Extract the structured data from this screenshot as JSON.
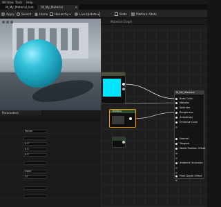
{
  "menu": [
    "Window",
    "Tools",
    "Help"
  ],
  "tabs": [
    {
      "label": "M_My_Material_Inst"
    },
    {
      "label": "M_My_Material",
      "active": true
    }
  ],
  "toolbar": {
    "apply": "Apply",
    "search": "Search",
    "home": "Home",
    "hierarchy": "Hierarchy",
    "live_update": "Live Update",
    "stats": "Stats",
    "platform_stats": "Platform Stats"
  },
  "graph": {
    "tab_label": "Material Graph",
    "node_b_label": "Multiply",
    "main_node": {
      "title": "M_My_Material",
      "inputs": [
        {
          "label": "Base Color",
          "connected": true
        },
        {
          "label": "Metallic",
          "connected": true
        },
        {
          "label": "Specular",
          "connected": false
        },
        {
          "label": "Roughness",
          "connected": true
        },
        {
          "label": "Anisotropy",
          "connected": false
        },
        {
          "label": "Emissive Color",
          "connected": false
        },
        {
          "label": "",
          "connected": false
        },
        {
          "label": "Normal",
          "connected": false
        },
        {
          "label": "Tangent",
          "connected": false
        },
        {
          "label": "World Position Offset",
          "connected": false
        },
        {
          "label": "",
          "connected": false
        },
        {
          "label": "",
          "connected": false
        },
        {
          "label": "Ambient Occlusion",
          "connected": false
        },
        {
          "label": "",
          "connected": false
        },
        {
          "label": "",
          "connected": false
        },
        {
          "label": "Pixel Depth Offset",
          "connected": false
        },
        {
          "label": "",
          "connected": false
        }
      ]
    }
  },
  "details": {
    "tab_label": "Parameters",
    "rows": [
      {
        "label": "",
        "value": "Param"
      },
      {
        "label": "",
        "value": ""
      },
      {
        "label": "",
        "value": "0.0"
      },
      {
        "label": "",
        "value": "0.0"
      },
      {
        "label": "",
        "value": "0.0"
      },
      {
        "label": "",
        "value": ""
      },
      {
        "label": "",
        "value": "None"
      },
      {
        "label": "",
        "value": "32"
      },
      {
        "label": "",
        "value": ""
      },
      {
        "label": "",
        "value": ""
      }
    ]
  },
  "colors": {
    "sphere": "#1fa8c2",
    "color_node_swatch": "#00e5ff",
    "selected_outline": "#ff9800",
    "graph_bg": "#1e1e1e"
  }
}
